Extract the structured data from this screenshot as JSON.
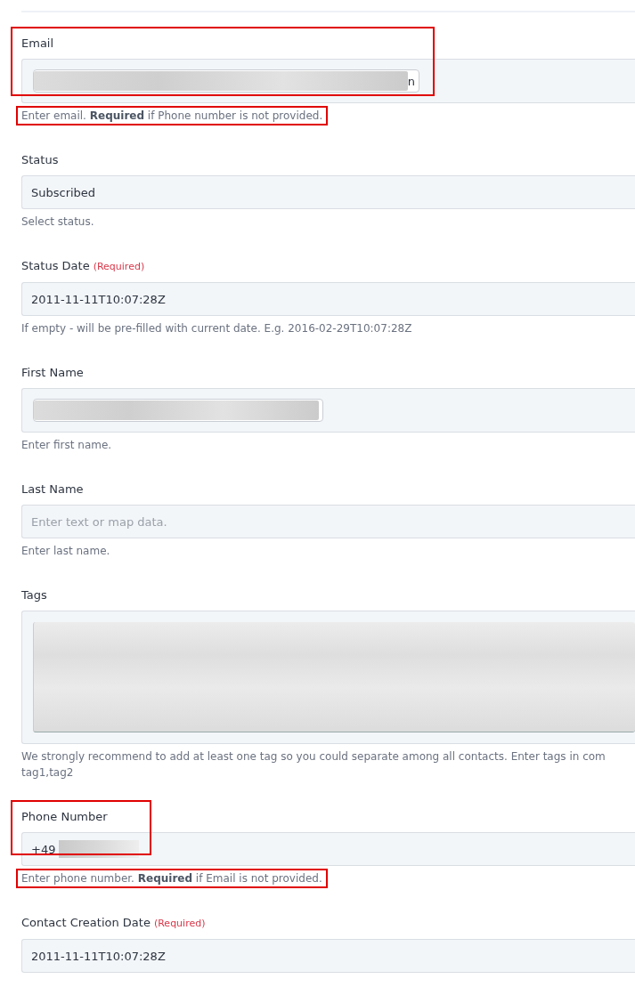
{
  "fields": [
    {
      "label": "Email",
      "kind": "redacted",
      "value": "n",
      "highlighted": true,
      "help": [
        "Enter email. **Required** if Phone number is not provided."
      ],
      "help_highlighted": true
    },
    {
      "label": "Status",
      "kind": "text",
      "value": "Subscribed",
      "highlighted": false,
      "help": [
        "Select status."
      ],
      "help_highlighted": false
    },
    {
      "label": "Status Date",
      "required_tag": "(Required)",
      "kind": "text",
      "value": "2011-11-11T10:07:28Z",
      "highlighted": false,
      "help": [
        "If empty - will be pre-filled with current date. E.g. 2016-02-29T10:07:28Z"
      ],
      "help_highlighted": false
    },
    {
      "label": "First Name",
      "kind": "redacted",
      "highlighted": false,
      "help": [
        "Enter first name."
      ],
      "help_highlighted": false
    },
    {
      "label": "Last Name",
      "kind": "placeholder",
      "placeholder": "Enter text or map data.",
      "highlighted": false,
      "help": [
        "Enter last name."
      ],
      "help_highlighted": false
    },
    {
      "label": "Tags",
      "kind": "redacted-area",
      "highlighted": false,
      "help": [
        "We strongly recommend to add at least one tag so you could separate among all contacts. Enter tags in com",
        "tag1,tag2"
      ],
      "help_highlighted": false
    },
    {
      "label": "Phone Number",
      "kind": "partial",
      "value": "+49",
      "highlighted": true,
      "help": [
        "Enter phone number. **Required** if Email is not provided."
      ],
      "help_highlighted": true
    },
    {
      "label": "Contact Creation Date",
      "required_tag": "(Required)",
      "kind": "text",
      "value": "2011-11-11T10:07:28Z",
      "highlighted": false
    }
  ]
}
